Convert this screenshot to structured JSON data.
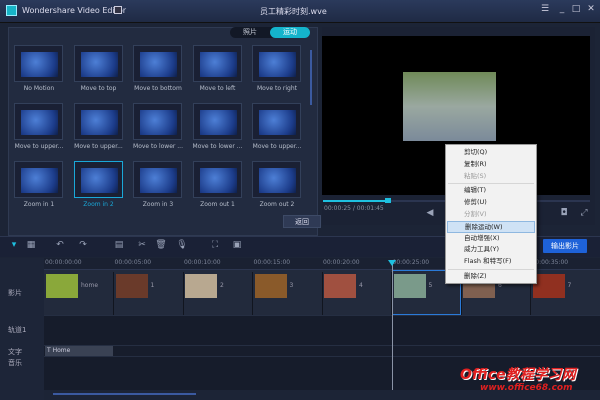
{
  "app": {
    "title": "Wondershare Video Editor",
    "file_title": "员工精彩时刻.wve"
  },
  "window_controls": [
    "menu",
    "minimize",
    "maximize",
    "close"
  ],
  "panel": {
    "tabs": [
      {
        "label": "照片",
        "active": false
      },
      {
        "label": "运动",
        "active": true
      }
    ],
    "effects": [
      {
        "label": "No Motion"
      },
      {
        "label": "Move to top"
      },
      {
        "label": "Move to bottom"
      },
      {
        "label": "Move to left"
      },
      {
        "label": "Move to right"
      },
      {
        "label": "Move to upper..."
      },
      {
        "label": "Move to upper..."
      },
      {
        "label": "Move to lower ..."
      },
      {
        "label": "Move to lower ..."
      },
      {
        "label": "Move to upper..."
      },
      {
        "label": "Zoom in 1"
      },
      {
        "label": "Zoom in 2",
        "selected": true
      },
      {
        "label": "Zoom in 3"
      },
      {
        "label": "Zoom out 1"
      },
      {
        "label": "Zoom out 2"
      }
    ],
    "back_label": "返回"
  },
  "preview": {
    "time": "00:00:25 / 00:01:45",
    "progress": 0.24
  },
  "toolbar": {
    "export_label": "输出影片"
  },
  "timeline": {
    "ruler": [
      "00:00:00:00",
      "00:00:05:00",
      "00:00:10:00",
      "00:00:15:00",
      "00:00:20:00",
      "00:00:25:00",
      "00:00:30:00",
      "00:00:35:00"
    ],
    "tracks": {
      "video": "影片",
      "track1": "轨道1",
      "text": "文字",
      "music": "音乐"
    },
    "clips": [
      "home",
      "1",
      "2",
      "3",
      "4",
      "5",
      "6",
      "7"
    ],
    "text_clip": "Home"
  },
  "context_menu": [
    {
      "label": "剪切(Q)"
    },
    {
      "label": "复制(R)"
    },
    {
      "label": "粘贴(S)",
      "disabled": true
    },
    {
      "sep": true
    },
    {
      "label": "编辑(T)"
    },
    {
      "label": "修剪(U)"
    },
    {
      "label": "分割(V)",
      "disabled": true
    },
    {
      "label": "删除运动(W)",
      "highlighted": true
    },
    {
      "label": "自动增强(X)"
    },
    {
      "label": "威力工具(Y)"
    },
    {
      "label": "Flash 和特写(F)"
    },
    {
      "sep": true
    },
    {
      "label": "删除(Z)"
    }
  ],
  "watermark": {
    "line1": "Office教程学习网",
    "line2": "www.office68.com"
  },
  "colors": {
    "accent": "#14b4cc",
    "export": "#1e62d8",
    "highlight": "#cfe2f5"
  }
}
